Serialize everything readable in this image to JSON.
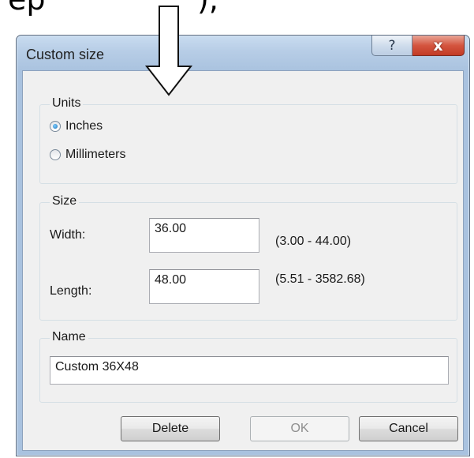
{
  "caption": {
    "left": "ep",
    "right": "),"
  },
  "window": {
    "title": "Custom size",
    "help_glyph": "?",
    "close_glyph": "x"
  },
  "units": {
    "label": "Units",
    "options": [
      "Inches",
      "Millimeters"
    ],
    "selected": "Inches"
  },
  "size": {
    "label": "Size",
    "width_label": "Width:",
    "width_value": "36.00",
    "width_range": "(3.00 - 44.00)",
    "length_label": "Length:",
    "length_value": "48.00",
    "length_range": "(5.51 - 3582.68)"
  },
  "name": {
    "label": "Name",
    "value": "Custom 36X48"
  },
  "buttons": {
    "delete": "Delete",
    "ok": "OK",
    "cancel": "Cancel"
  }
}
